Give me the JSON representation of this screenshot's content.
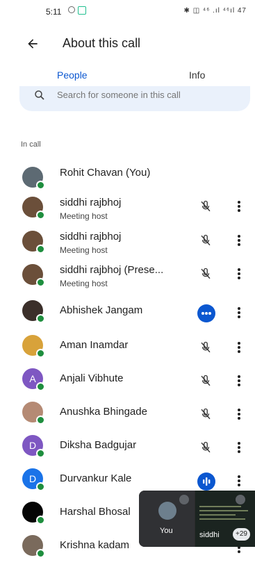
{
  "status_bar": {
    "time": "5:11",
    "right_indicators": "✱ ◫ ⁴⁶ .ıl ⁴⁶ıl 47"
  },
  "header": {
    "title": "About this call"
  },
  "tabs": [
    {
      "label": "People"
    },
    {
      "label": "Info"
    }
  ],
  "search": {
    "placeholder": "Search for someone in this call"
  },
  "section": {
    "label": "In call"
  },
  "participants": [
    {
      "name": "Rohit Chavan (You)",
      "role": "",
      "avatar": "photo",
      "mic": "none"
    },
    {
      "name": "siddhi rajbhoj",
      "role": "Meeting host",
      "avatar": "photo",
      "mic": "muted"
    },
    {
      "name": "siddhi rajbhoj",
      "role": "Meeting host",
      "avatar": "photo",
      "mic": "muted"
    },
    {
      "name": "siddhi rajbhoj (Prese...",
      "role": "Meeting host",
      "avatar": "photo",
      "mic": "muted"
    },
    {
      "name": "Abhishek Jangam",
      "role": "",
      "avatar": "photo",
      "mic": "speaking-dots"
    },
    {
      "name": "Aman Inamdar",
      "role": "",
      "avatar": "photo",
      "mic": "muted"
    },
    {
      "name": "Anjali Vibhute",
      "role": "",
      "avatar_letter": "A",
      "avatar_color": "#7e57c2",
      "mic": "muted"
    },
    {
      "name": "Anushka Bhingade",
      "role": "",
      "avatar": "photo",
      "mic": "muted"
    },
    {
      "name": "Diksha Badgujar",
      "role": "",
      "avatar_letter": "D",
      "avatar_color": "#7e57c2",
      "mic": "muted"
    },
    {
      "name": "Durvankur Kale",
      "role": "",
      "avatar_letter": "D",
      "avatar_color": "#1a73e8",
      "mic": "speaking-bars"
    },
    {
      "name": "Harshal Bhosal",
      "role": "",
      "avatar": "dark",
      "mic": "hidden"
    },
    {
      "name": "Krishna kadam",
      "role": "",
      "avatar": "photo",
      "mic": "hidden"
    }
  ],
  "pip": {
    "self_label": "You",
    "remote_label": "siddhi",
    "extra_count": "+29"
  },
  "colors": {
    "accent": "#0b57d0",
    "online": "#1e8e3e",
    "search_bg": "#eaf1fb"
  },
  "icons": {
    "back": "arrow-back-icon",
    "search": "search-icon",
    "mic_off": "mic-off-icon",
    "more": "more-vert-icon"
  }
}
